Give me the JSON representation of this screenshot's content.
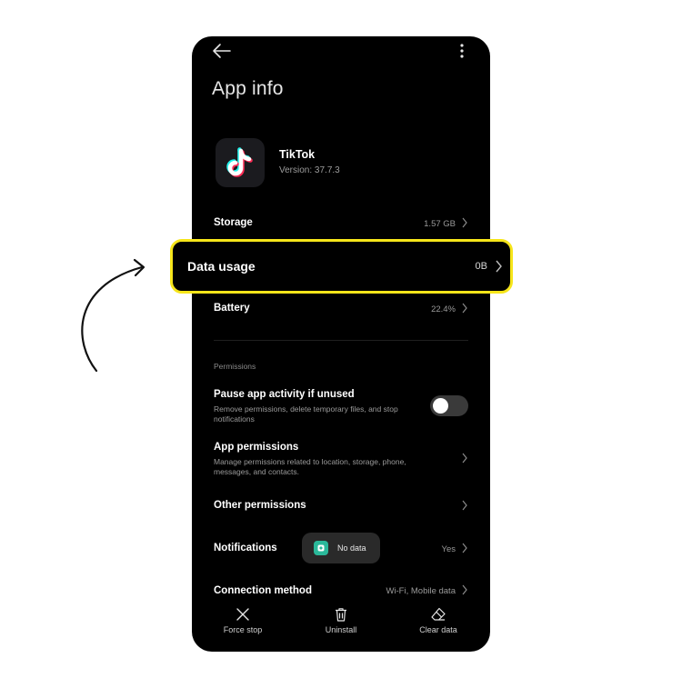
{
  "header": {
    "title": "App info"
  },
  "app": {
    "name": "TikTok",
    "version": "Version: 37.7.3"
  },
  "rows": {
    "storage": {
      "label": "Storage",
      "value": "1.57 GB"
    },
    "data_usage": {
      "label": "Data usage",
      "value": "0B"
    },
    "battery": {
      "label": "Battery",
      "value": "22.4%"
    }
  },
  "permissions": {
    "section_label": "Permissions",
    "pause": {
      "title": "Pause app activity if unused",
      "desc": "Remove permissions, delete temporary files, and stop notifications",
      "toggle_on": false
    },
    "app_permissions": {
      "title": "App permissions",
      "desc": "Manage permissions related to location, storage, phone, messages, and contacts."
    },
    "other": {
      "title": "Other permissions"
    },
    "notifications": {
      "title": "Notifications",
      "value": "Yes"
    },
    "connection": {
      "title": "Connection method",
      "value": "Wi-Fi, Mobile data"
    }
  },
  "toast": {
    "text": "No data",
    "icon": "app-icon"
  },
  "actions": {
    "force_stop": "Force stop",
    "uninstall": "Uninstall",
    "clear_data": "Clear data"
  },
  "colors": {
    "highlight": "#f6e51a",
    "background": "#000000",
    "toast_icon": "#2bb89a"
  }
}
